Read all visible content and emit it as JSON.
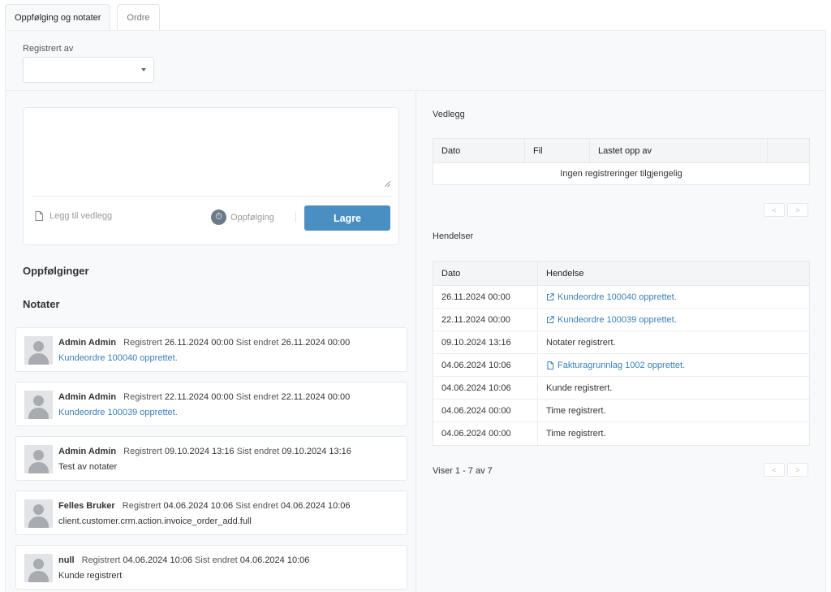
{
  "tabs": [
    {
      "label": "Oppfølging og notater",
      "active": true
    },
    {
      "label": "Ordre",
      "active": false
    }
  ],
  "filter": {
    "label": "Registrert av",
    "value": ""
  },
  "editor": {
    "placeholder": "",
    "attach_label": "Legg til vedlegg",
    "followup_label": "Oppfølging",
    "save_label": "Lagre",
    "save_color": "#4a8fc2"
  },
  "sections": {
    "followups": "Oppfølginger",
    "notes": "Notater"
  },
  "notes": [
    {
      "user": "Admin Admin",
      "registered_label": "Registrert",
      "registered": "26.11.2024 00:00",
      "changed_label": "Sist endret",
      "changed": "26.11.2024 00:00",
      "text": "Kundeordre 100040 opprettet.",
      "is_link": true
    },
    {
      "user": "Admin Admin",
      "registered_label": "Registrert",
      "registered": "22.11.2024 00:00",
      "changed_label": "Sist endret",
      "changed": "22.11.2024 00:00",
      "text": "Kundeordre 100039 opprettet.",
      "is_link": true
    },
    {
      "user": "Admin Admin",
      "registered_label": "Registrert",
      "registered": "09.10.2024 13:16",
      "changed_label": "Sist endret",
      "changed": "09.10.2024 13:16",
      "text": "Test av notater",
      "is_link": false
    },
    {
      "user": "Felles Bruker",
      "registered_label": "Registrert",
      "registered": "04.06.2024 10:06",
      "changed_label": "Sist endret",
      "changed": "04.06.2024 10:06",
      "text": "client.customer.crm.action.invoice_order_add.full",
      "is_link": false
    },
    {
      "user": "null",
      "registered_label": "Registrert",
      "registered": "04.06.2024 10:06",
      "changed_label": "Sist endret",
      "changed": "04.06.2024 10:06",
      "text": "Kunde registrert",
      "is_link": false
    }
  ],
  "attachments": {
    "title": "Vedlegg",
    "columns": [
      "Dato",
      "Fil",
      "Lastet opp av",
      ""
    ],
    "empty_text": "Ingen registreringer tilgjengelig"
  },
  "events": {
    "title": "Hendelser",
    "columns": [
      "Dato",
      "Hendelse"
    ],
    "rows": [
      {
        "date": "26.11.2024 00:00",
        "text": "Kundeordre 100040 opprettet.",
        "icon": "external-link-icon",
        "is_link": true
      },
      {
        "date": "22.11.2024 00:00",
        "text": "Kundeordre 100039 opprettet.",
        "icon": "external-link-icon",
        "is_link": true
      },
      {
        "date": "09.10.2024 13:16",
        "text": "Notater registrert.",
        "icon": "",
        "is_link": false
      },
      {
        "date": "04.06.2024 10:06",
        "text": "Fakturagrunnlag 1002 opprettet.",
        "icon": "document-icon",
        "is_link": true
      },
      {
        "date": "04.06.2024 10:06",
        "text": "Kunde registrert.",
        "icon": "",
        "is_link": false
      },
      {
        "date": "04.06.2024 00:00",
        "text": "Time registrert.",
        "icon": "",
        "is_link": false
      },
      {
        "date": "04.06.2024 00:00",
        "text": "Time registrert.",
        "icon": "",
        "is_link": false
      }
    ],
    "showing": "Viser 1 - 7 av 7"
  },
  "colors": {
    "link": "#3a7fb8",
    "accent": "#4a8fc2"
  }
}
